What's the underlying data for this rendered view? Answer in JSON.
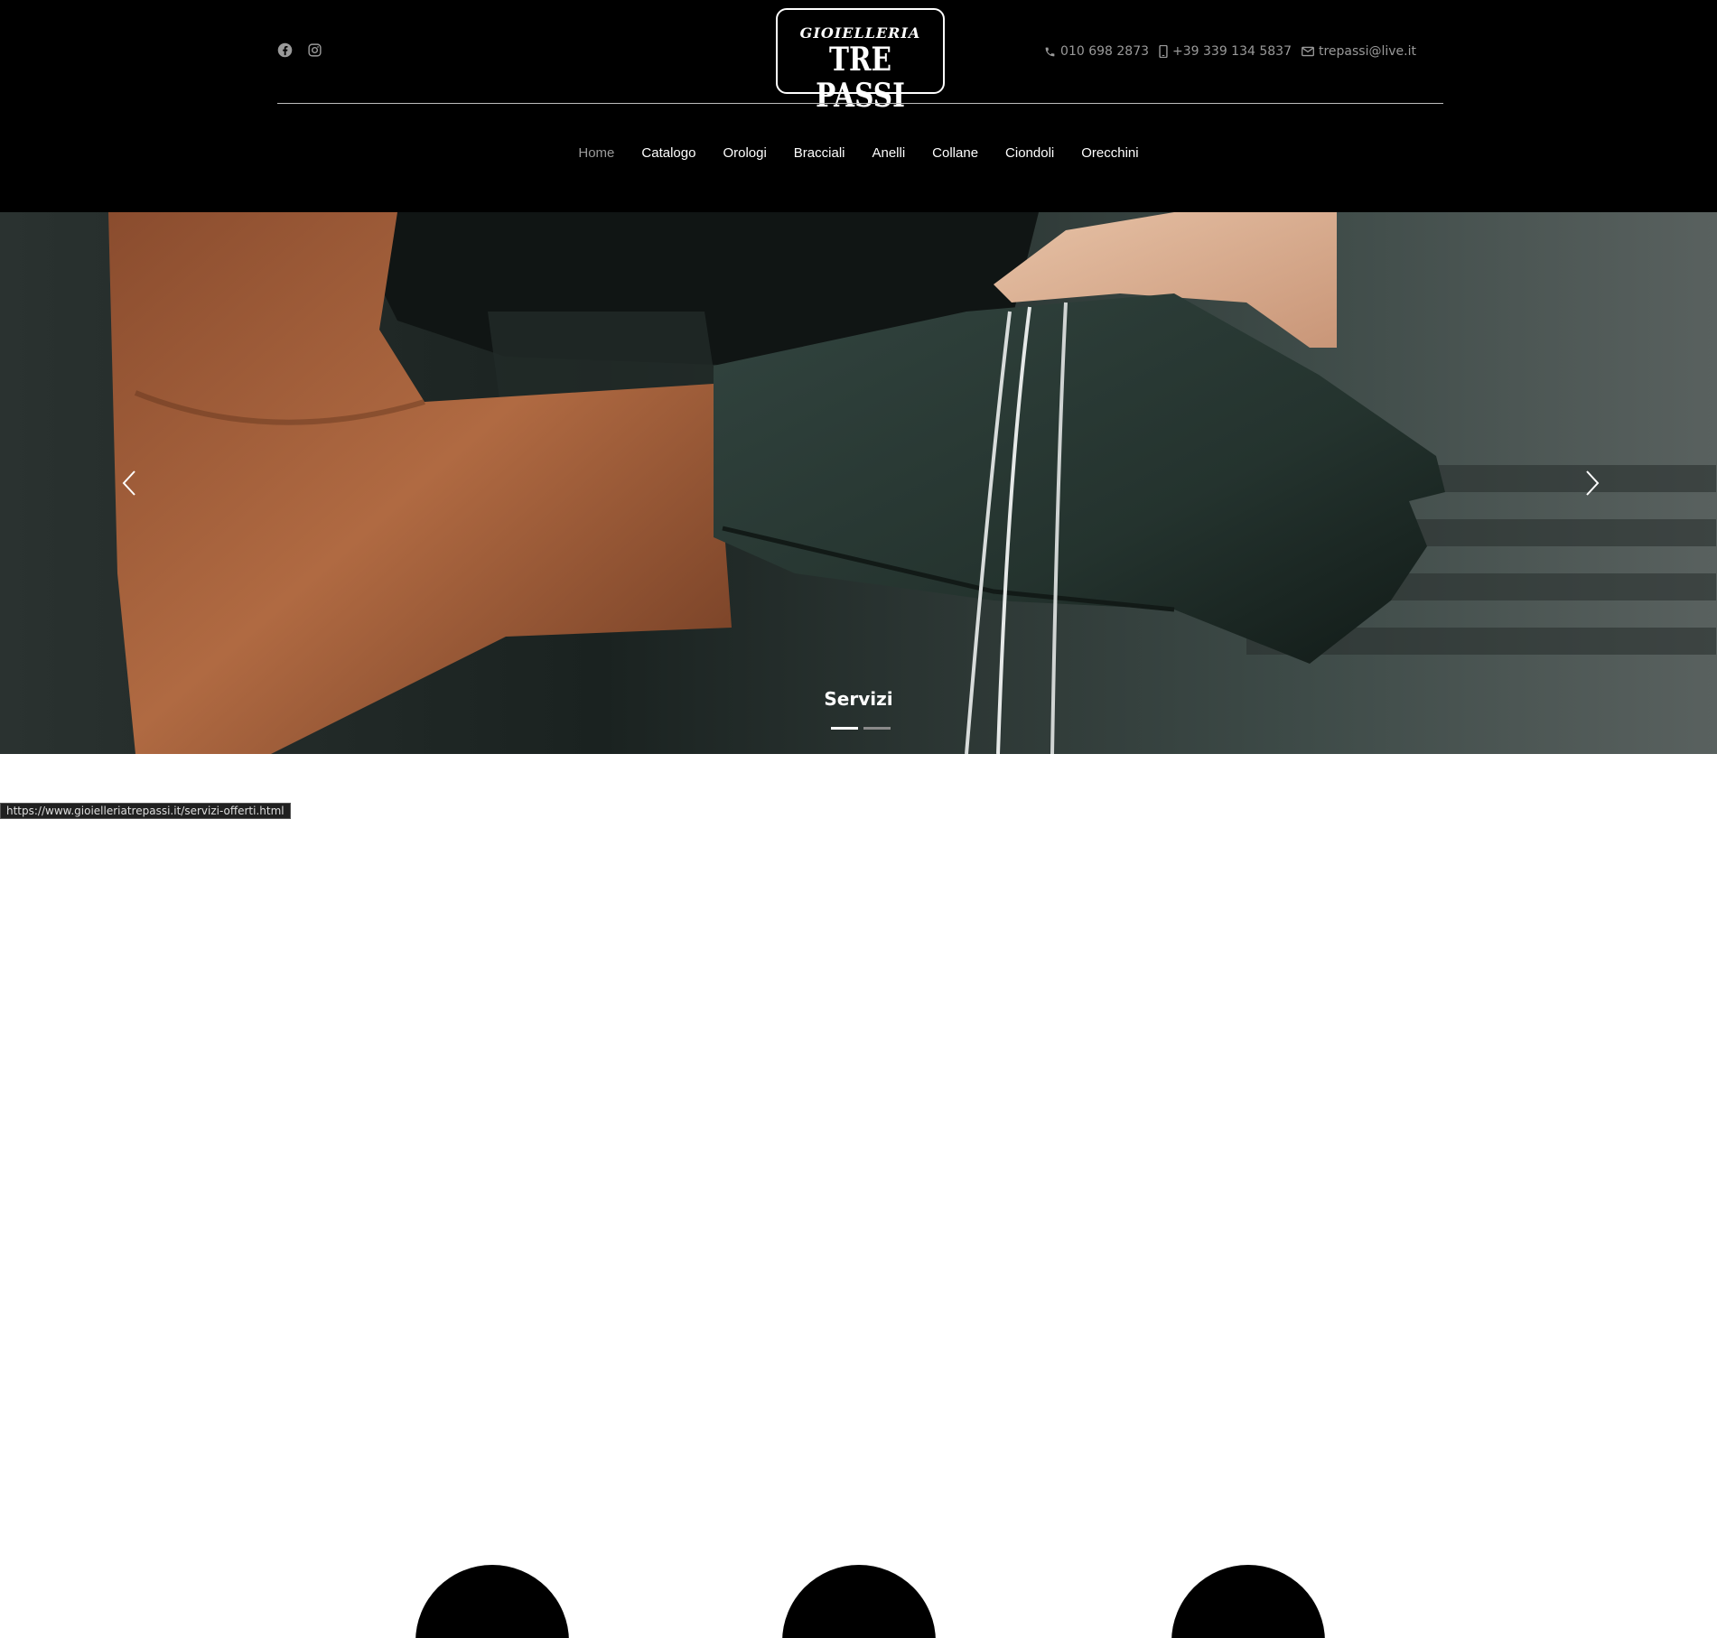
{
  "header": {
    "social": [
      {
        "icon": "facebook-icon"
      },
      {
        "icon": "instagram-icon"
      }
    ],
    "logo": {
      "line1": "GIOIELLERIA",
      "line2": "TRE PASSI"
    },
    "contacts": {
      "phone": "010 698 2873",
      "mobile": "+39 339 134 5837",
      "email": "trepassi@live.it"
    }
  },
  "nav": {
    "items": [
      {
        "label": "Home",
        "active": true
      },
      {
        "label": "Catalogo"
      },
      {
        "label": "Orologi"
      },
      {
        "label": "Bracciali"
      },
      {
        "label": "Anelli"
      },
      {
        "label": "Collane"
      },
      {
        "label": "Ciondoli"
      },
      {
        "label": "Orecchini"
      }
    ]
  },
  "hero": {
    "caption": "Servizi",
    "slides_count": 2,
    "active_slide": 1
  },
  "status_bar": {
    "url": "https://www.gioielleriatrepassi.it/servizi-offerti.html"
  },
  "colors": {
    "header_bg": "#000000",
    "nav_active": "#9a9a9a",
    "glove": "#24332e"
  }
}
